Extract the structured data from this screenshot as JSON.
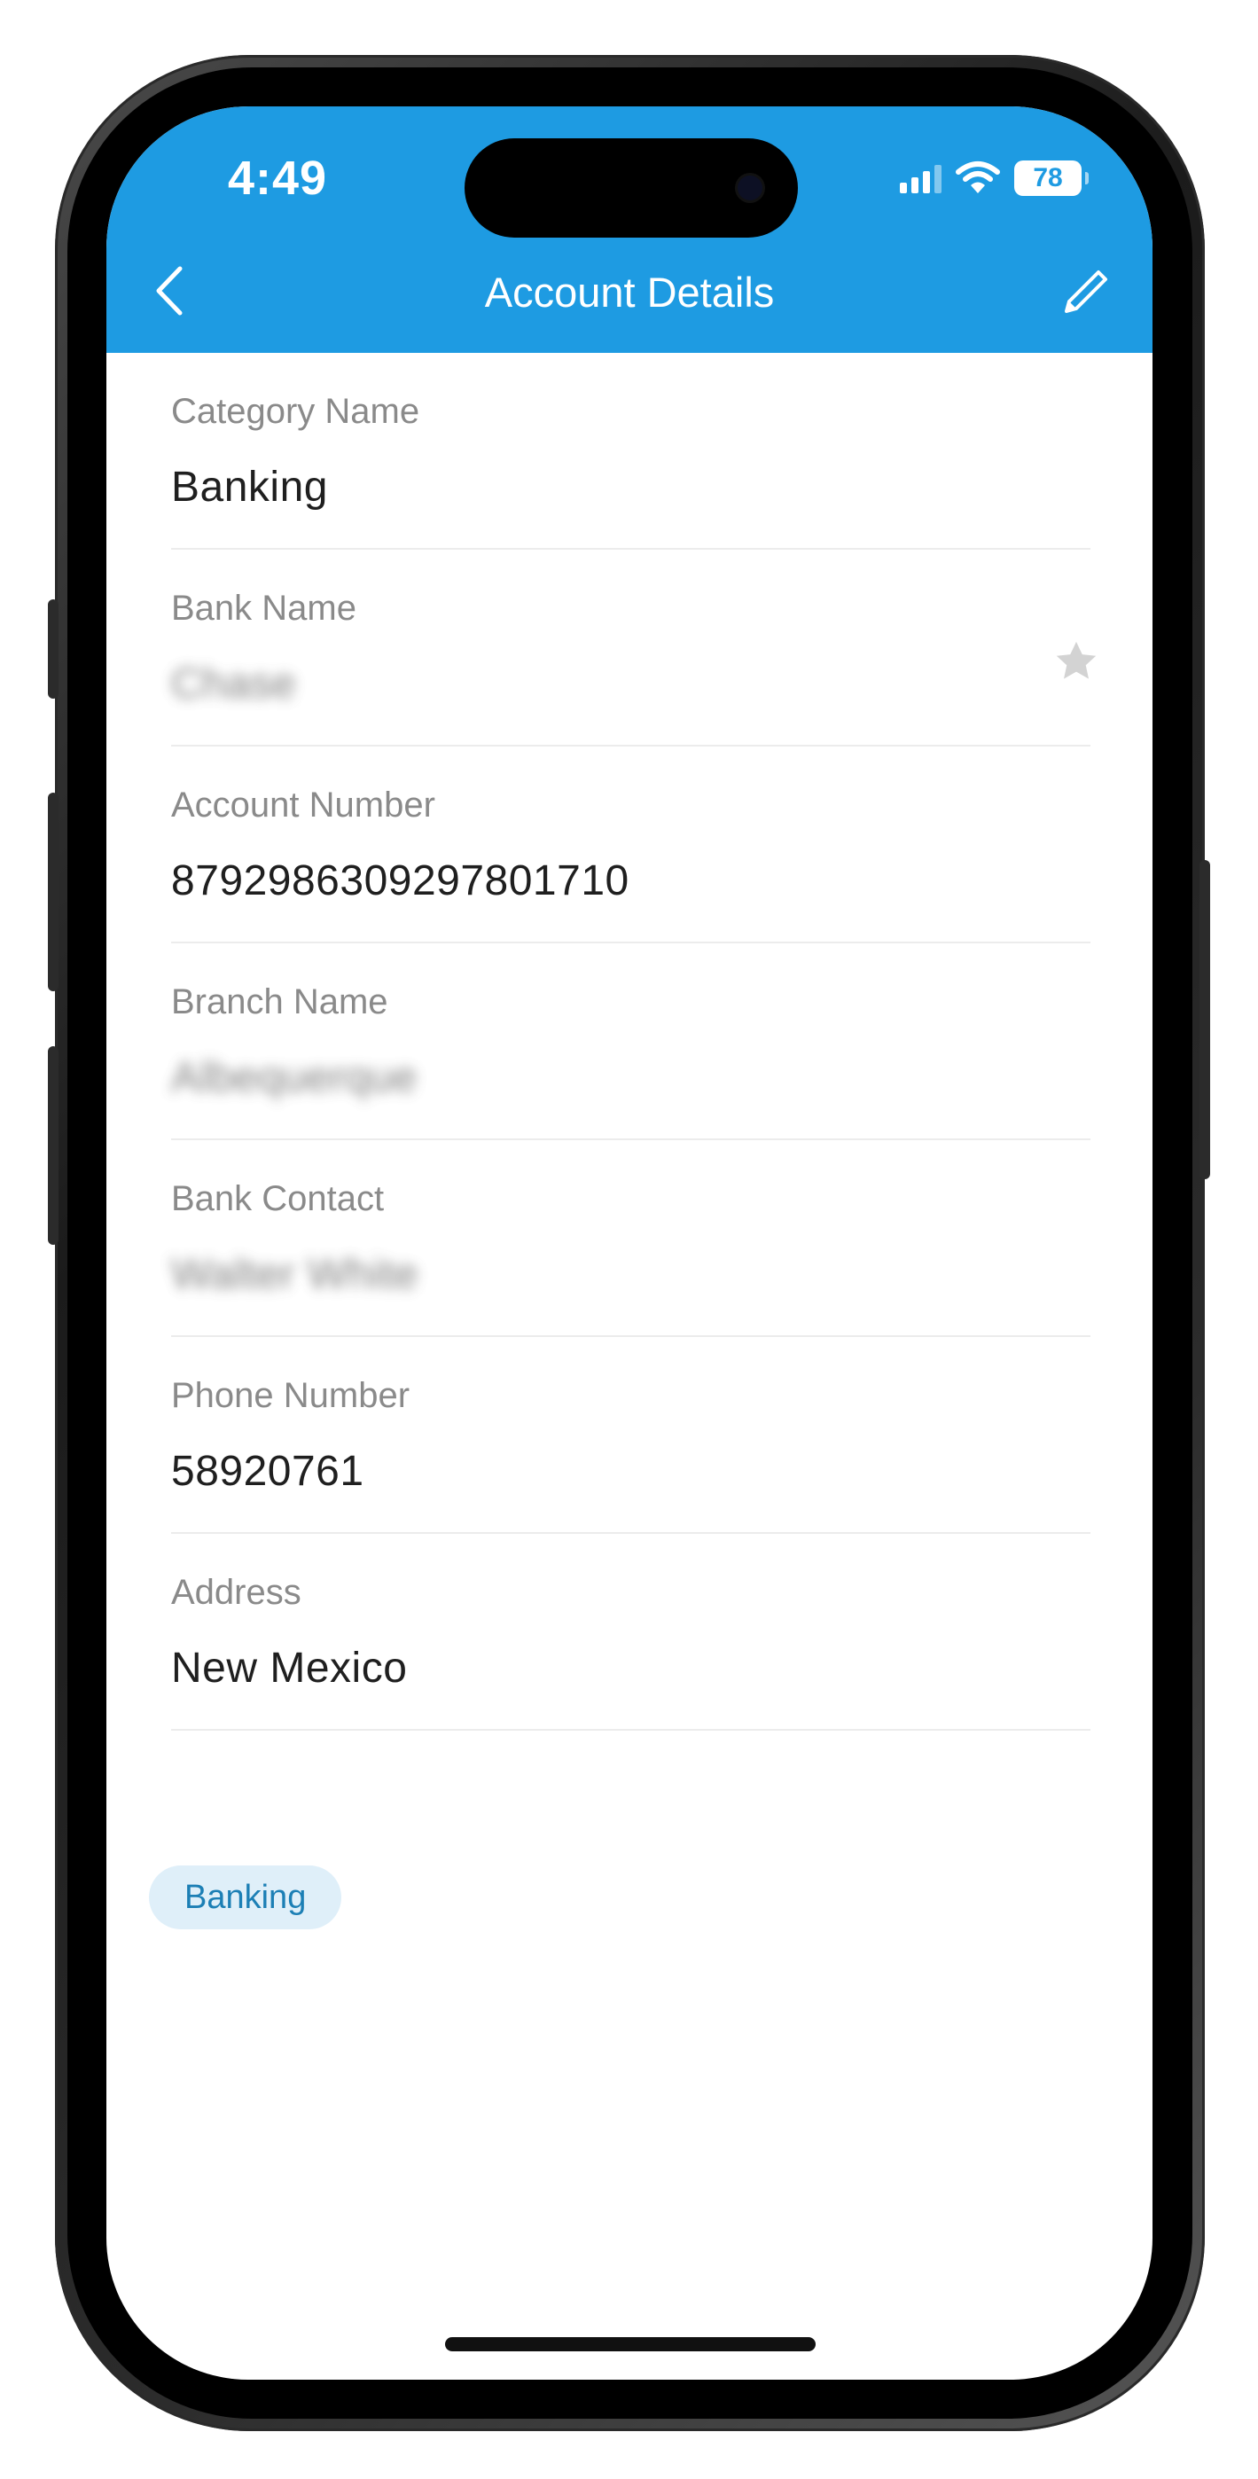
{
  "status_bar": {
    "time": "4:49",
    "battery_percent": "78",
    "signal_icon": "cellular-signal-icon",
    "wifi_icon": "wifi-icon"
  },
  "header": {
    "title": "Account Details",
    "back_icon": "chevron-left-icon",
    "edit_icon": "pencil-icon",
    "background_color": "#1e9be2"
  },
  "fields": [
    {
      "label": "Category Name",
      "value": "Banking"
    },
    {
      "label": "Bank Name",
      "value": "Chase",
      "blurred": true,
      "favorite_icon": "star-icon"
    },
    {
      "label": "Account Number",
      "value": "8792986309297801710"
    },
    {
      "label": "Branch Name",
      "value": "Albequerque",
      "blurred": true
    },
    {
      "label": "Bank Contact",
      "value": "Walter White",
      "blurred": true
    },
    {
      "label": "Phone Number",
      "value": "58920761"
    },
    {
      "label": "Address",
      "value": "New Mexico"
    }
  ],
  "tags": [
    "Banking"
  ],
  "colors": {
    "accent": "#1e9be2",
    "tag_background": "#dfeff9",
    "tag_text": "#1c7fb5"
  }
}
